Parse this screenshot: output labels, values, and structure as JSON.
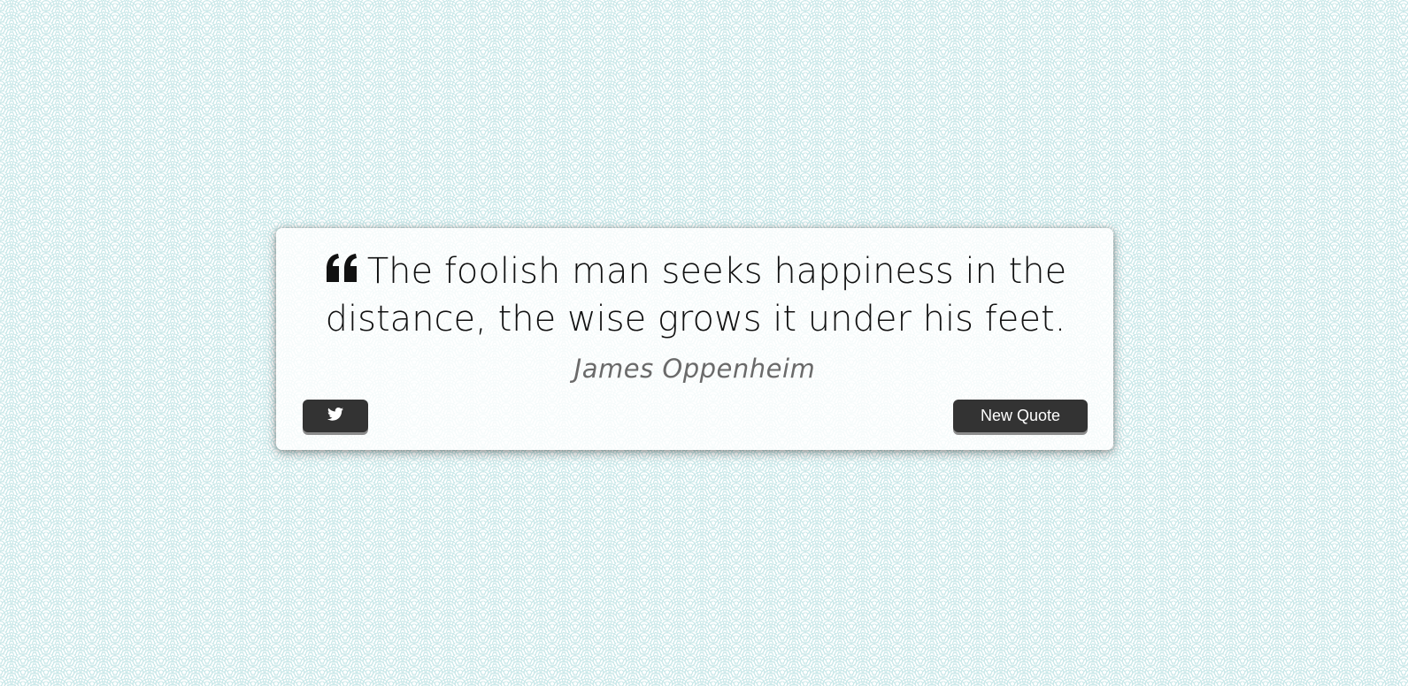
{
  "quote": {
    "icon": "quote-left-icon",
    "text": "The foolish man seeks happiness in the distance, the wise grows it under his feet.",
    "author": "James Oppenheim"
  },
  "buttons": {
    "tweet_icon": "twitter-icon",
    "new_quote_label": "New Quote"
  },
  "colors": {
    "pattern": "#cce9ea",
    "button_bg": "#333333",
    "button_text": "#ffffff",
    "quote_text": "#111111",
    "author_text": "#6a6a6a"
  }
}
